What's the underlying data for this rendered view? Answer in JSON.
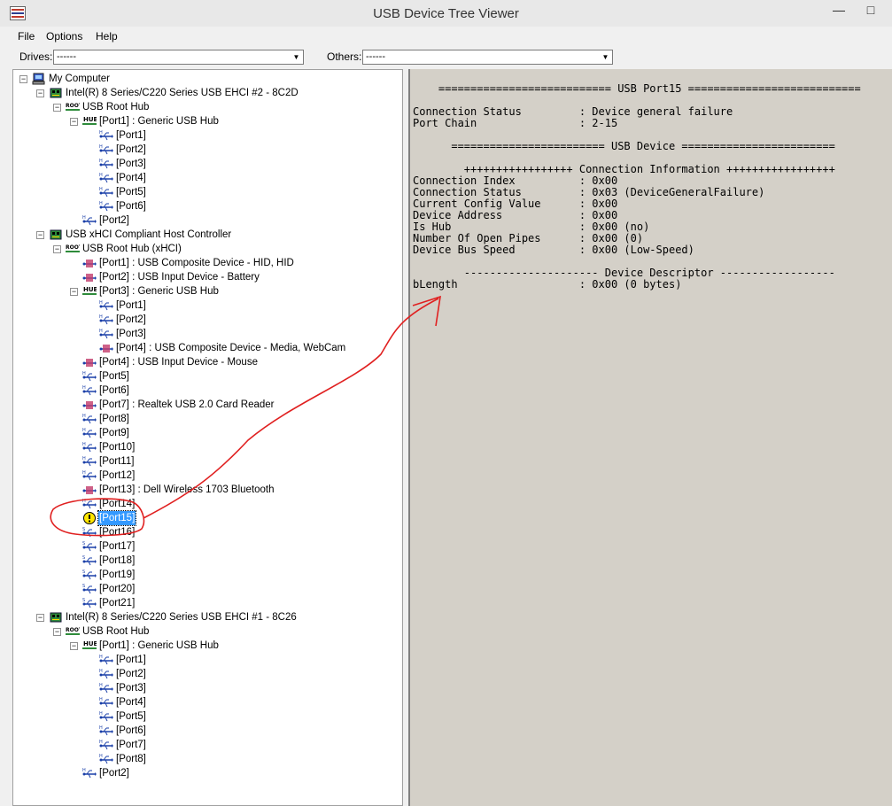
{
  "window": {
    "title": "USB Device Tree Viewer",
    "minimize_glyph": "—",
    "maximize_glyph": "□"
  },
  "menu": [
    "File",
    "Options",
    "Help"
  ],
  "toolbar": {
    "drives_label": "Drives:",
    "drives_value": "------",
    "others_label": "Others:",
    "others_value": "------"
  },
  "tree": [
    {
      "label": "My Computer",
      "icon": "computer",
      "indent": 0,
      "expander": "minus"
    },
    {
      "label": "Intel(R) 8 Series/C220 Series USB EHCI #2 - 8C2D",
      "icon": "controller",
      "indent": 1,
      "expander": "minus"
    },
    {
      "label": "USB Root Hub",
      "icon": "roothub",
      "indent": 2,
      "expander": "minus"
    },
    {
      "label": "[Port1] : Generic USB Hub",
      "icon": "hub",
      "indent": 3,
      "expander": "minus"
    },
    {
      "label": "[Port1]",
      "icon": "port",
      "indent": 4
    },
    {
      "label": "[Port2]",
      "icon": "port",
      "indent": 4
    },
    {
      "label": "[Port3]",
      "icon": "port",
      "indent": 4
    },
    {
      "label": "[Port4]",
      "icon": "port",
      "indent": 4
    },
    {
      "label": "[Port5]",
      "icon": "port",
      "indent": 4
    },
    {
      "label": "[Port6]",
      "icon": "port",
      "indent": 4
    },
    {
      "label": "[Port2]",
      "icon": "port",
      "indent": 3
    },
    {
      "label": "USB xHCI Compliant Host Controller",
      "icon": "controller",
      "indent": 1,
      "expander": "minus"
    },
    {
      "label": "USB Root Hub (xHCI)",
      "icon": "roothub",
      "indent": 2,
      "expander": "minus"
    },
    {
      "label": "[Port1] : USB Composite Device - HID, HID",
      "icon": "device",
      "indent": 3
    },
    {
      "label": "[Port2] : USB Input Device - Battery",
      "icon": "device",
      "indent": 3
    },
    {
      "label": "[Port3] : Generic USB Hub",
      "icon": "hub",
      "indent": 3,
      "expander": "minus"
    },
    {
      "label": "[Port1]",
      "icon": "port",
      "indent": 4
    },
    {
      "label": "[Port2]",
      "icon": "port",
      "indent": 4
    },
    {
      "label": "[Port3]",
      "icon": "port",
      "indent": 4
    },
    {
      "label": "[Port4] : USB Composite Device - Media, WebCam",
      "icon": "device",
      "indent": 4
    },
    {
      "label": "[Port4] : USB Input Device - Mouse",
      "icon": "device",
      "indent": 3
    },
    {
      "label": "[Port5]",
      "icon": "port",
      "indent": 3
    },
    {
      "label": "[Port6]",
      "icon": "port",
      "indent": 3
    },
    {
      "label": "[Port7] : Realtek USB 2.0 Card Reader",
      "icon": "device",
      "indent": 3
    },
    {
      "label": "[Port8]",
      "icon": "port",
      "indent": 3
    },
    {
      "label": "[Port9]",
      "icon": "port",
      "indent": 3
    },
    {
      "label": "[Port10]",
      "icon": "port",
      "indent": 3
    },
    {
      "label": "[Port11]",
      "icon": "port",
      "indent": 3
    },
    {
      "label": "[Port12]",
      "icon": "port",
      "indent": 3
    },
    {
      "label": "[Port13] : Dell Wireless 1703 Bluetooth",
      "icon": "device",
      "indent": 3
    },
    {
      "label": "[Port14]",
      "icon": "port",
      "indent": 3
    },
    {
      "label": "[Port15]",
      "icon": "warning",
      "indent": 3,
      "selected": true
    },
    {
      "label": "[Port16]",
      "icon": "ssport",
      "indent": 3
    },
    {
      "label": "[Port17]",
      "icon": "ssport",
      "indent": 3
    },
    {
      "label": "[Port18]",
      "icon": "ssport",
      "indent": 3
    },
    {
      "label": "[Port19]",
      "icon": "ssport",
      "indent": 3
    },
    {
      "label": "[Port20]",
      "icon": "ssport",
      "indent": 3
    },
    {
      "label": "[Port21]",
      "icon": "ssport",
      "indent": 3
    },
    {
      "label": "Intel(R) 8 Series/C220 Series USB EHCI #1 - 8C26",
      "icon": "controller",
      "indent": 1,
      "expander": "minus"
    },
    {
      "label": "USB Root Hub",
      "icon": "roothub",
      "indent": 2,
      "expander": "minus"
    },
    {
      "label": "[Port1] : Generic USB Hub",
      "icon": "hub",
      "indent": 3,
      "expander": "minus"
    },
    {
      "label": "[Port1]",
      "icon": "port",
      "indent": 4
    },
    {
      "label": "[Port2]",
      "icon": "port",
      "indent": 4
    },
    {
      "label": "[Port3]",
      "icon": "port",
      "indent": 4
    },
    {
      "label": "[Port4]",
      "icon": "port",
      "indent": 4
    },
    {
      "label": "[Port5]",
      "icon": "port",
      "indent": 4
    },
    {
      "label": "[Port6]",
      "icon": "port",
      "indent": 4
    },
    {
      "label": "[Port7]",
      "icon": "port",
      "indent": 4
    },
    {
      "label": "[Port8]",
      "icon": "port",
      "indent": 4
    },
    {
      "label": "[Port2]",
      "icon": "port",
      "indent": 3
    }
  ],
  "details": [
    "    =========================== USB Port15 ===========================",
    "",
    "Connection Status         : Device general failure",
    "Port Chain                : 2-15",
    "",
    "      ======================== USB Device ========================",
    "",
    "        +++++++++++++++++ Connection Information +++++++++++++++++",
    "Connection Index          : 0x00",
    "Connection Status         : 0x03 (DeviceGeneralFailure)",
    "Current Config Value      : 0x00",
    "Device Address            : 0x00",
    "Is Hub                    : 0x00 (no)",
    "Number Of Open Pipes      : 0x00 (0)",
    "Device Bus Speed          : 0x00 (Low-Speed)",
    "",
    "        --------------------- Device Descriptor ------------------",
    "bLength                   : 0x00 (0 bytes)"
  ],
  "annotation_color": "#e02020",
  "hub_text": "HUB",
  "root_text": "ROOT"
}
